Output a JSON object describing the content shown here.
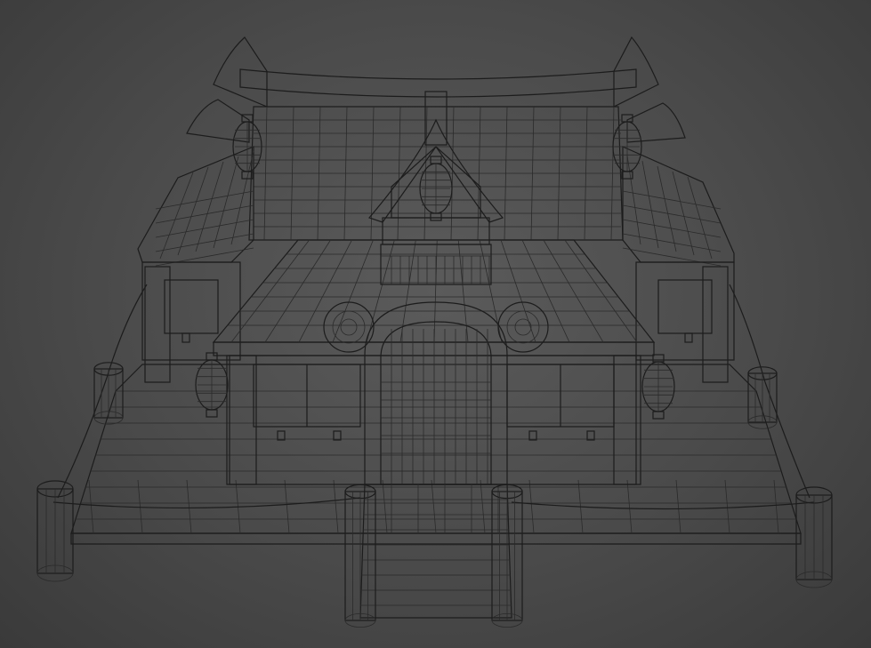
{
  "scene": {
    "background_color": "#4a4a4a",
    "model_fill_light": "#c4c4c4",
    "model_fill_mid": "#a9a9a9",
    "model_fill_dark": "#8e8e8e",
    "wire_color": "#1c1c1c"
  }
}
